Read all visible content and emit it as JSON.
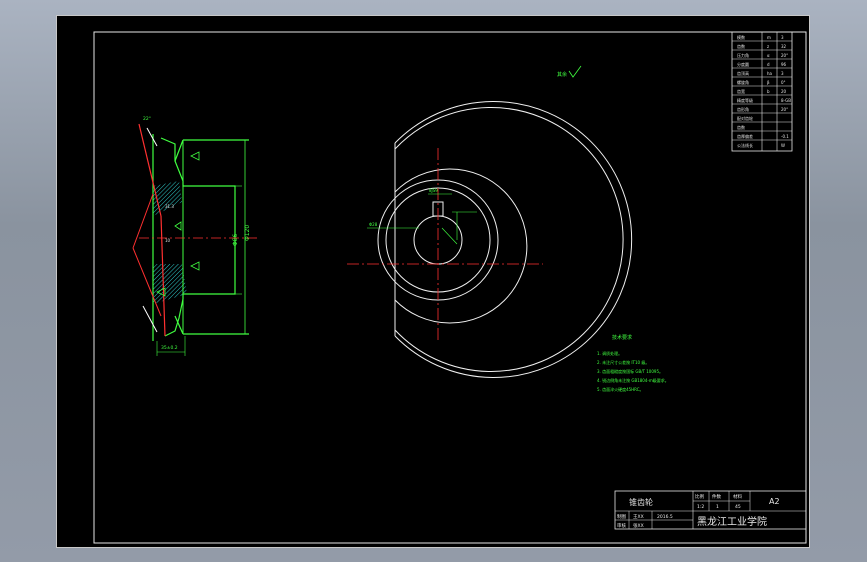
{
  "title_block": {
    "part_name": "锥齿轮",
    "scale_label": "比例",
    "scale_value": "1:2",
    "qty_label": "件数",
    "qty_value": "1",
    "material_label": "材料",
    "material_value": "45",
    "sheet_size": "A2",
    "drawn_label": "制图",
    "checked_label": "审核",
    "drawn_name": "王XX",
    "checked_name": "张XX",
    "date": "2016.5",
    "school": "黑龙江工业学院"
  },
  "roughness_note": "其余",
  "tech_requirements": {
    "heading": "技术要求",
    "items": [
      "1. 调质处理。",
      "2. 未注尺寸公差按 IT10 级。",
      "3. 齿面粗糙度按国标 GB/T 10095。",
      "4. 锐边倒角未注按 GB1804-m级要求。",
      "5. 齿面淬火硬度45HRC。"
    ]
  },
  "param_table": {
    "rows": [
      [
        "模数",
        "m",
        "3"
      ],
      [
        "齿数",
        "z",
        "32"
      ],
      [
        "压力角",
        "α",
        "20°"
      ],
      [
        "分度圆",
        "d",
        "96"
      ],
      [
        "齿顶高",
        "ha",
        "3"
      ],
      [
        "螺旋角",
        "β",
        "0°"
      ],
      [
        "齿宽",
        "b",
        "20"
      ],
      [
        "精度等级",
        "",
        "8-GB"
      ],
      [
        "齿形角",
        "",
        "20°"
      ],
      [
        "配对齿轮",
        "",
        ""
      ],
      [
        "齿数",
        "",
        ""
      ],
      [
        "齿厚偏差",
        "",
        "-0.1"
      ],
      [
        "公法线长",
        "",
        "W"
      ]
    ]
  },
  "dims": {
    "d_outer": "Φ120",
    "d_inner": "Φ86",
    "d_bore": "Φ28",
    "width_bottom": "35±0.2",
    "keyway": "8JS9",
    "hub_w": "10",
    "slot_depth": "31.3",
    "angle": "22°"
  }
}
